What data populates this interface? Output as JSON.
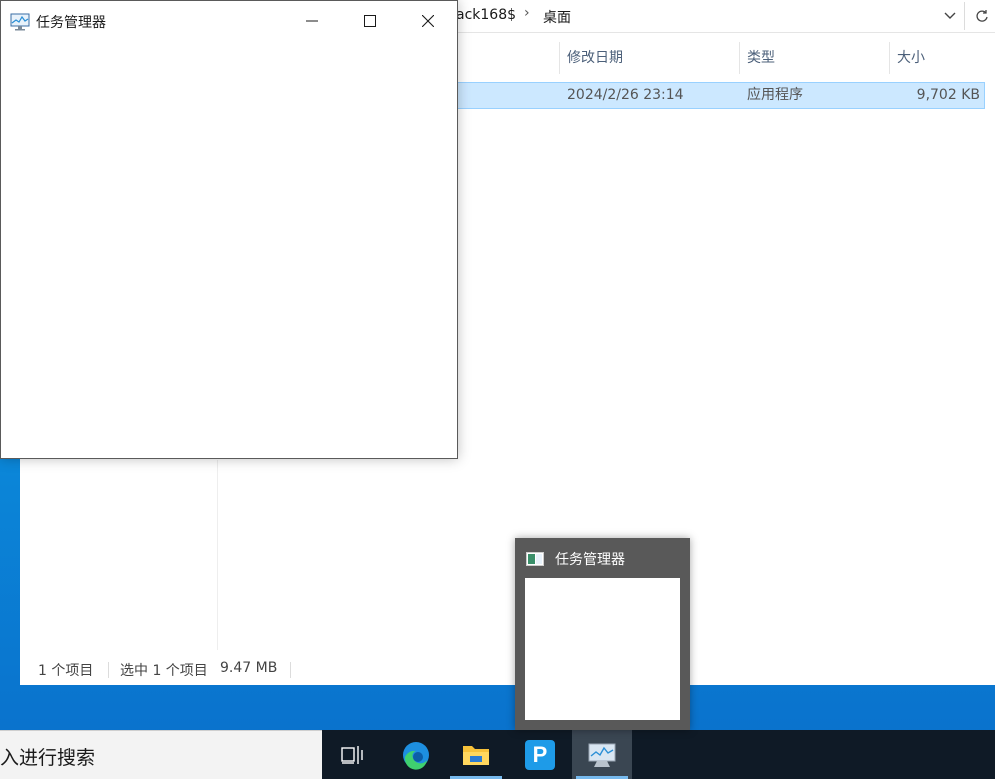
{
  "explorer": {
    "breadcrumb": {
      "segment_partial": "ack168$",
      "separator": "›",
      "segment_current": "桌面"
    },
    "columns": [
      {
        "label": "修改日期"
      },
      {
        "label": "类型"
      },
      {
        "label": "大小"
      }
    ],
    "file_row": {
      "modified": "2024/2/26 23:14",
      "type": "应用程序",
      "size": "9,702 KB"
    },
    "status": {
      "item_count": "1 个项目",
      "selected": "选中 1 个项目",
      "selected_size": "9.47 MB"
    }
  },
  "task_manager": {
    "title": "任务管理器",
    "minimize_glyph": "—",
    "maximize_glyph": "☐",
    "close_glyph": "✕"
  },
  "taskbar": {
    "search_text": "入进行搜索",
    "buttons": [
      {
        "name": "task-view",
        "icon": "task-view-icon"
      },
      {
        "name": "edge",
        "icon": "edge-icon"
      },
      {
        "name": "file-explorer",
        "icon": "folder-icon"
      },
      {
        "name": "p-app",
        "icon": "p-app-icon",
        "glyph": "P"
      },
      {
        "name": "task-manager",
        "icon": "task-manager-icon",
        "active": true
      }
    ]
  },
  "thumbnail": {
    "title": "任务管理器"
  },
  "colors": {
    "desktop": "#0b86d8",
    "selection": "#cce8ff",
    "taskbar": "#0f1a26",
    "thumbnail_bg": "#595959"
  }
}
